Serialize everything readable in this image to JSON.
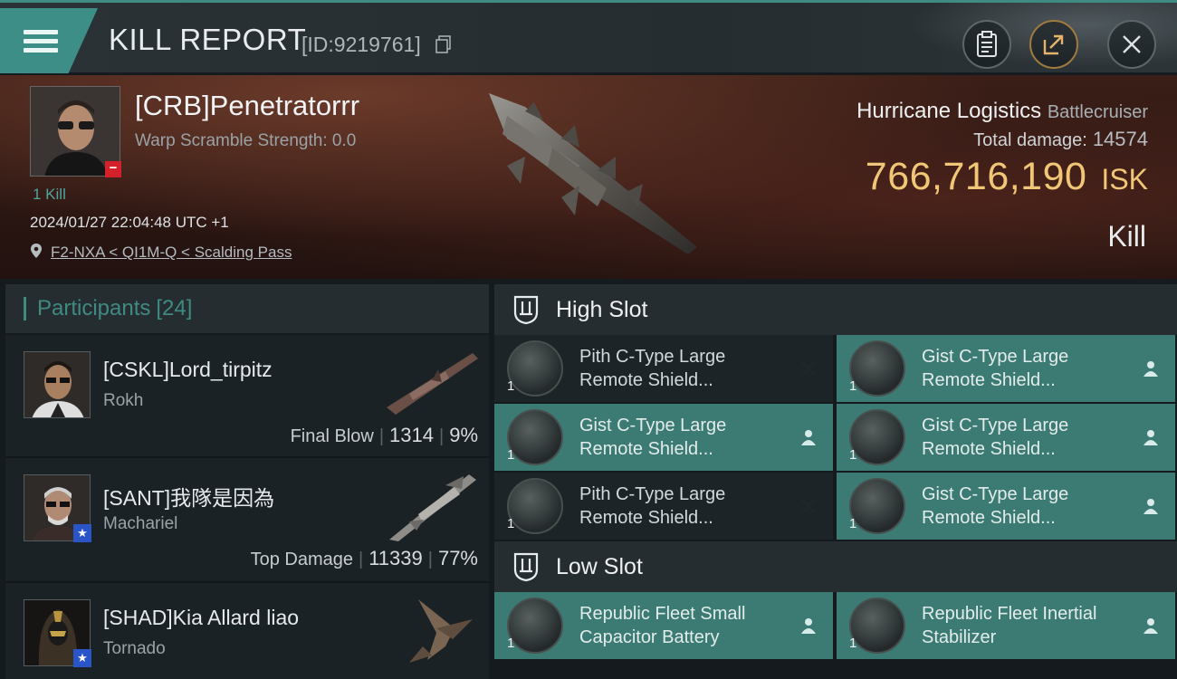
{
  "header": {
    "title": "KILL REPORT",
    "id_text": "[ID:9219761]",
    "icons": [
      "menu-icon",
      "copy-icon",
      "clipboard-icon",
      "share-icon",
      "close-icon"
    ]
  },
  "victim": {
    "name": "[CRB]Penetratorrr",
    "warp_scramble": "Warp Scramble Strength: 0.0",
    "kill_count": "1 Kill",
    "datetime": "2024/01/27 22:04:48 UTC +1",
    "location": "F2-NXA < QI1M-Q < Scalding Pass",
    "ship_name": "Hurricane Logistics",
    "ship_class": "Battlecruiser",
    "total_damage_label": "Total damage:",
    "total_damage": "14574",
    "isk_value": "766,716,190",
    "isk_unit": "ISK",
    "result": "Kill"
  },
  "participants": {
    "label": "Participants",
    "count": "[24]",
    "items": [
      {
        "name": "[CSKL]Lord_tirpitz",
        "ship": "Rokh",
        "role": "Final Blow",
        "damage": "1314",
        "percent": "9%",
        "star": false
      },
      {
        "name": "[SANT]我隊是因為",
        "ship": "Machariel",
        "role": "Top Damage",
        "damage": "11339",
        "percent": "77%",
        "star": true
      },
      {
        "name": "[SHAD]Kia Allard liao",
        "ship": "Tornado",
        "role": "",
        "damage": "",
        "percent": "",
        "star": true
      }
    ]
  },
  "slots": {
    "high": {
      "label": "High Slot",
      "modules": [
        {
          "name1": "Pith C-Type Large",
          "name2": "Remote Shield...",
          "qty": "1",
          "state": "destroyed",
          "style": "dark"
        },
        {
          "name1": "Gist C-Type Large",
          "name2": "Remote Shield...",
          "qty": "1",
          "state": "dropped",
          "style": "teal"
        },
        {
          "name1": "Gist C-Type Large",
          "name2": "Remote Shield...",
          "qty": "1",
          "state": "dropped",
          "style": "teal"
        },
        {
          "name1": "Gist C-Type Large",
          "name2": "Remote Shield...",
          "qty": "1",
          "state": "dropped",
          "style": "teal"
        },
        {
          "name1": "Pith C-Type Large",
          "name2": "Remote Shield...",
          "qty": "1",
          "state": "destroyed",
          "style": "dark"
        },
        {
          "name1": "Gist C-Type Large",
          "name2": "Remote Shield...",
          "qty": "1",
          "state": "dropped",
          "style": "teal"
        }
      ]
    },
    "low": {
      "label": "Low Slot",
      "modules": [
        {
          "name1": "Republic Fleet Small",
          "name2": "Capacitor Battery",
          "qty": "1",
          "state": "dropped",
          "style": "teal"
        },
        {
          "name1": "Republic Fleet Inertial",
          "name2": "Stabilizer",
          "qty": "1",
          "state": "dropped",
          "style": "teal"
        }
      ]
    }
  },
  "colors": {
    "accent": "#3f8b82",
    "isk": "#f1c777",
    "badge_red": "#d4202a"
  }
}
